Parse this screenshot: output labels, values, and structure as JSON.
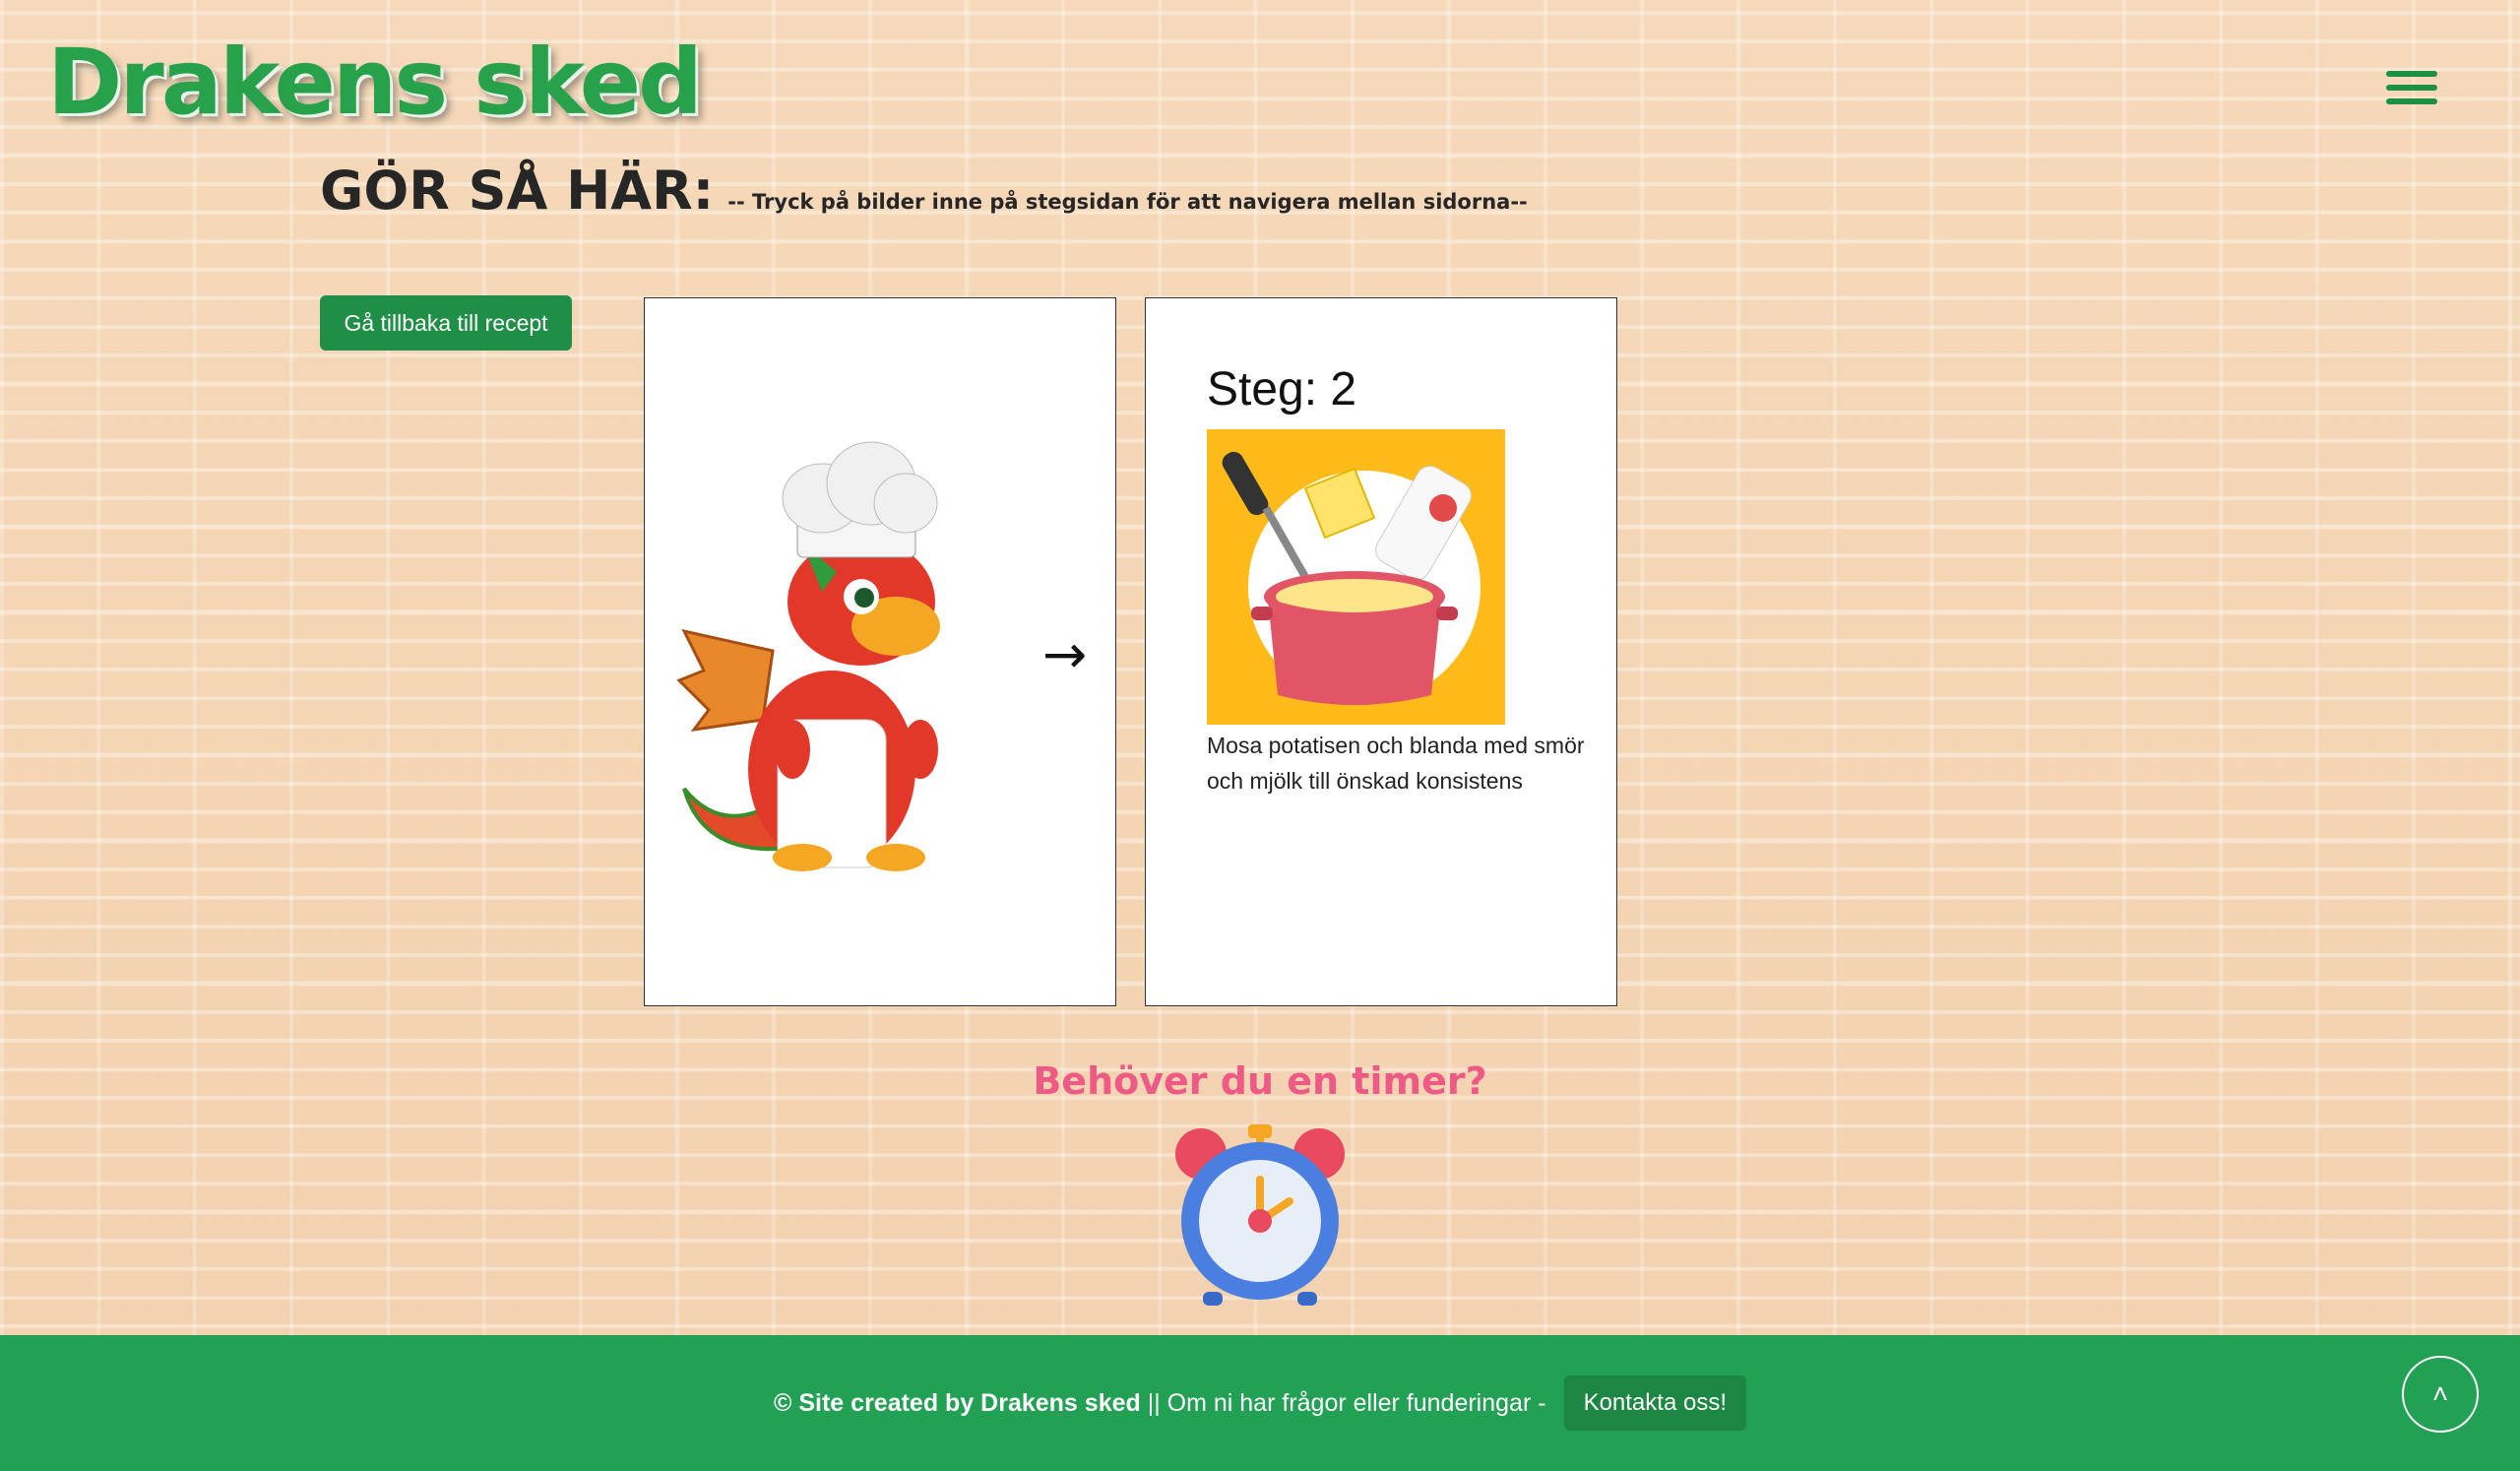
{
  "header": {
    "logo": "Drakens sked",
    "menu_icon": "hamburger-icon"
  },
  "instructions": {
    "title": "GÖR SÅ HÄR:",
    "subtitle": "-- Tryck på bilder inne på stegsidan för att navigera mellan sidorna--"
  },
  "back_button": "Gå tillbaka till recept",
  "left_card": {
    "image": "chef-dragon-image",
    "next_arrow": "→"
  },
  "step": {
    "title": "Steg: 2",
    "image": "pot-mashing-image",
    "text": "Mosa potatisen och blanda med smör och mjölk till önskad konsistens"
  },
  "timer": {
    "title": "Behöver du en timer?",
    "icon": "alarm-clock-icon"
  },
  "footer": {
    "credit": "© Site created by Drakens sked",
    "separator": " || Om ni har frågor eller funderingar -",
    "contact_button": "Kontakta oss!",
    "scroll_top": "˄"
  },
  "colors": {
    "brand_green": "#22a053",
    "button_green": "#1f8e46",
    "timer_pink": "#ee5a86",
    "background_brick": "#f4d6b6"
  }
}
